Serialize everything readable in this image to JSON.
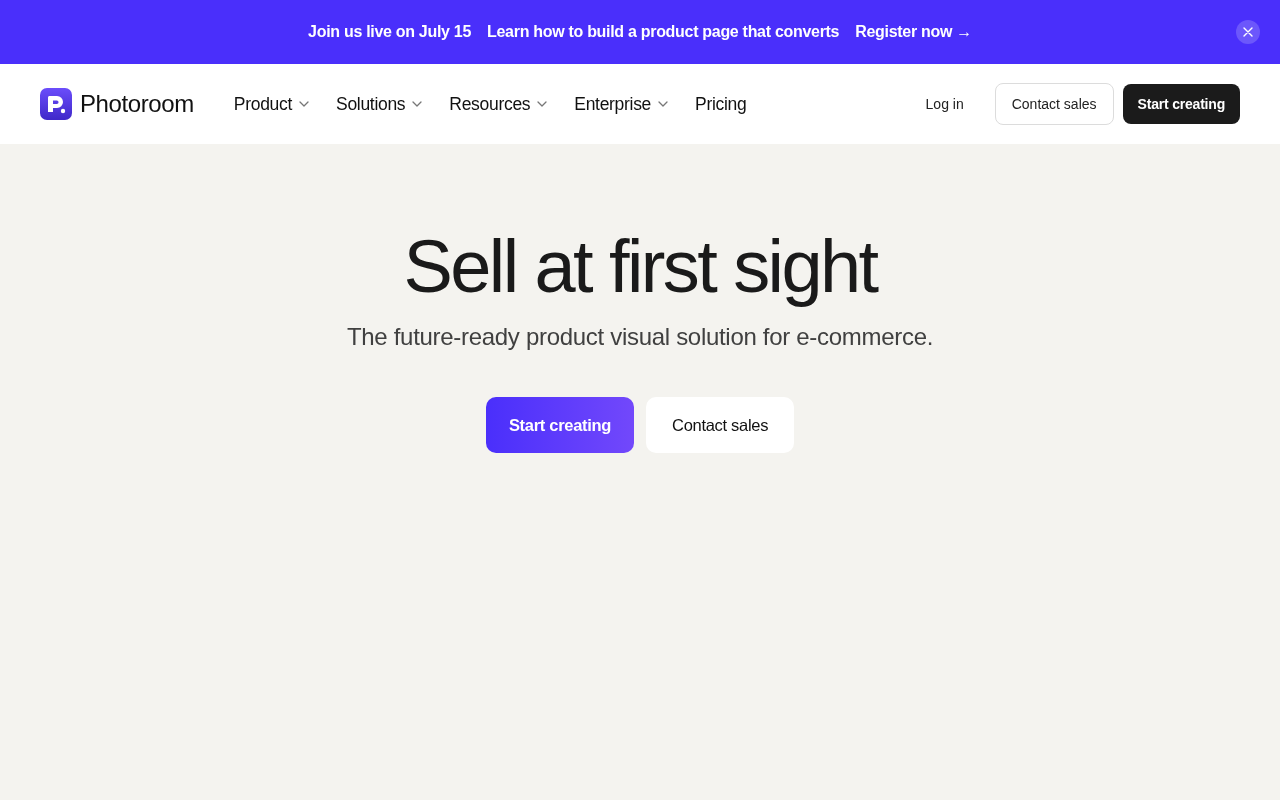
{
  "banner": {
    "headline": "Join us live on July 15",
    "message": "Learn how to build a product page that converts",
    "link": "Register now →"
  },
  "nav": {
    "brand": "Photoroom",
    "menu": [
      {
        "label": "Product",
        "dropdown": true
      },
      {
        "label": "Solutions",
        "dropdown": true
      },
      {
        "label": "Resources",
        "dropdown": true
      },
      {
        "label": "Enterprise",
        "dropdown": true
      },
      {
        "label": "Pricing",
        "dropdown": false
      }
    ],
    "actions": [
      {
        "label": "Log in",
        "kind": "link"
      },
      {
        "label": "Contact sales",
        "kind": "outline"
      },
      {
        "label": "Start creating",
        "kind": "dark"
      }
    ]
  },
  "hero": {
    "title": "Sell at first sight",
    "subtitle": "The future-ready product visual solution for e-commerce.",
    "buttons": [
      {
        "label": "Start creating",
        "kind": "primary"
      },
      {
        "label": "Contact sales",
        "kind": "secondary"
      }
    ]
  }
}
